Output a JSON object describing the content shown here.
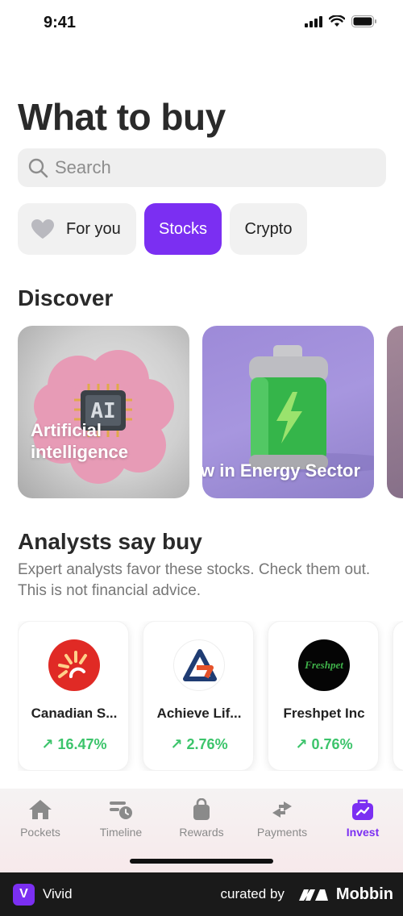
{
  "status_bar": {
    "time": "9:41"
  },
  "page": {
    "title": "What to buy"
  },
  "search": {
    "placeholder": "Search"
  },
  "chips": [
    {
      "label": "For you",
      "icon": "heart-icon",
      "active": false
    },
    {
      "label": "Stocks",
      "active": true
    },
    {
      "label": "Crypto",
      "active": false
    }
  ],
  "discover": {
    "title": "Discover",
    "cards": [
      {
        "label": "Artificial\nintelligence"
      },
      {
        "label": "w in Energy Sector"
      }
    ]
  },
  "analysts": {
    "title": "Analysts say buy",
    "subtitle": "Expert analysts favor these stocks. Check them out. This is not financial advice.",
    "stocks": [
      {
        "name": "Canadian S...",
        "change": "16.47%"
      },
      {
        "name": "Achieve Lif...",
        "change": "2.76%"
      },
      {
        "name": "Freshpet Inc",
        "change": "0.76%",
        "logo_text": "Freshpet"
      }
    ]
  },
  "tabbar": {
    "items": [
      {
        "label": "Pockets",
        "active": false
      },
      {
        "label": "Timeline",
        "active": false
      },
      {
        "label": "Rewards",
        "active": false
      },
      {
        "label": "Payments",
        "active": false
      },
      {
        "label": "Invest",
        "active": true
      }
    ]
  },
  "footer": {
    "brand": "Vivid",
    "brand_initial": "V",
    "curated": "curated by",
    "mobbin": "Mobbin"
  },
  "colors": {
    "accent": "#7b2ff2",
    "positive": "#3cc46b"
  }
}
